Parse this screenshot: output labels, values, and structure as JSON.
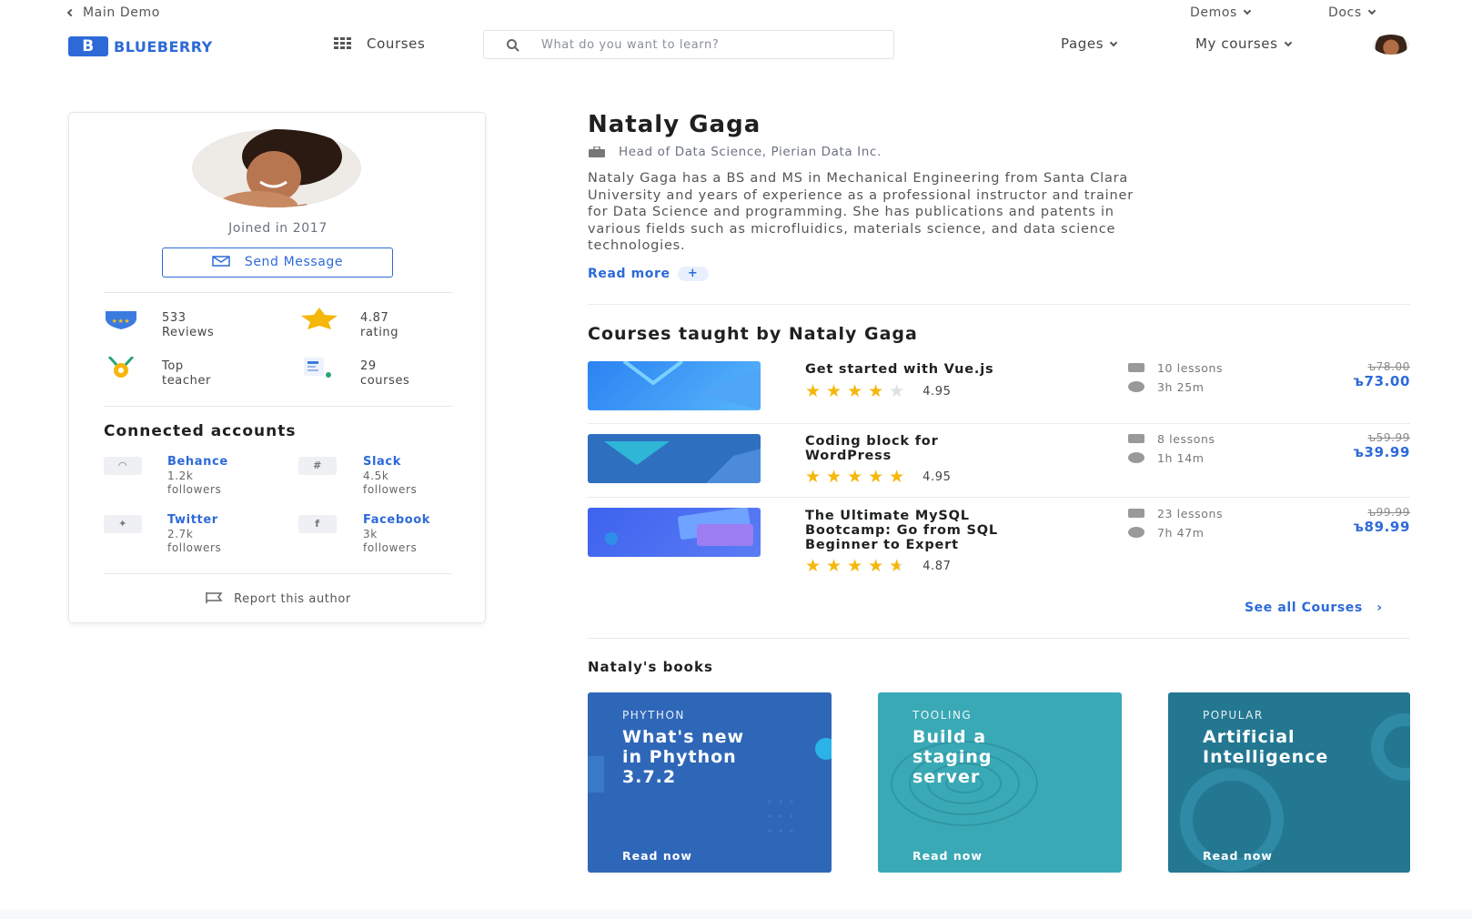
{
  "topbar": {
    "back_label": "Main Demo",
    "demos_label": "Demos",
    "docs_label": "Docs"
  },
  "header": {
    "logo_letter": "B",
    "logo_text": "BLUEBERRY",
    "courses_label": "Courses",
    "search_placeholder": "What do you want to learn?",
    "pages_label": "Pages",
    "my_courses_label": "My courses"
  },
  "profile": {
    "joined": "Joined in 2017",
    "send_message": "Send Message",
    "stats": [
      {
        "value": "533",
        "label": "Reviews",
        "icon": "shield-icon"
      },
      {
        "value": "4.87",
        "label": "rating",
        "icon": "star-icon"
      },
      {
        "value": "Top",
        "label": "teacher",
        "icon": "medal-icon"
      },
      {
        "value": "29",
        "label": "courses",
        "icon": "courses-icon"
      }
    ],
    "connected_title": "Connected accounts",
    "accounts": [
      {
        "name": "Behance",
        "count": "1.2k",
        "unit": "followers",
        "icon": "github-icon"
      },
      {
        "name": "Slack",
        "count": "4.5k",
        "unit": "followers",
        "icon": "slack-icon"
      },
      {
        "name": "Twitter",
        "count": "2.7k",
        "unit": "followers",
        "icon": "twitter-icon"
      },
      {
        "name": "Facebook",
        "count": "3k",
        "unit": "followers",
        "icon": "facebook-icon"
      }
    ],
    "report": "Report this author"
  },
  "author": {
    "name": "Nataly Gaga",
    "role": "Head of Data Science, Pierian Data Inc.",
    "bio_lines": [
      "Nataly Gaga has a BS and MS in Mechanical Engineering from Santa Clara",
      "University and years of experience as a professional instructor and trainer",
      "for Data Science and programming. She has publications and patents in",
      "various fields such as microfluidics, materials science, and data science",
      "technologies."
    ],
    "read_more": "Read more"
  },
  "courses": {
    "title": "Courses taught by Nataly Gaga",
    "items": [
      {
        "title_lines": [
          "Get started with Vue.js"
        ],
        "rating": "4.95",
        "lessons": "10 lessons",
        "duration": "3h 25m",
        "old_price": "ъ78.00",
        "price": "ъ73.00",
        "stars_full": 4,
        "stars_half": 0,
        "thumb_color": "#3b8ff0"
      },
      {
        "title_lines": [
          "Coding block for",
          "WordPress"
        ],
        "rating": "4.95",
        "lessons": "8 lessons",
        "duration": "1h 14m",
        "old_price": "ъ59.99",
        "price": "ъ39.99",
        "stars_full": 5,
        "stars_half": 0,
        "thumb_color": "#2f6fc0"
      },
      {
        "title_lines": [
          "The Ultimate MySQL",
          "Bootcamp: Go from SQL",
          "Beginner to Expert"
        ],
        "rating": "4.87",
        "lessons": "23 lessons",
        "duration": "7h 47m",
        "old_price": "ъ99.99",
        "price": "ъ89.99",
        "stars_full": 4,
        "stars_half": 1,
        "thumb_color": "#4a6cf0"
      }
    ],
    "see_all": "See all Courses"
  },
  "books": {
    "title": "Nataly's books",
    "items": [
      {
        "category": "PHYTHON",
        "title_lines": [
          "What's new",
          "in Phython",
          "3.7.2"
        ],
        "cta": "Read now",
        "color": "#2f67b8"
      },
      {
        "category": "TOOLING",
        "title_lines": [
          "Build a",
          "staging",
          "server"
        ],
        "cta": "Read now",
        "color": "#3aa9b6"
      },
      {
        "category": "POPULAR",
        "title_lines": [
          "Artificial",
          "Intelligence"
        ],
        "cta": "Read now",
        "color": "#237791"
      }
    ]
  }
}
